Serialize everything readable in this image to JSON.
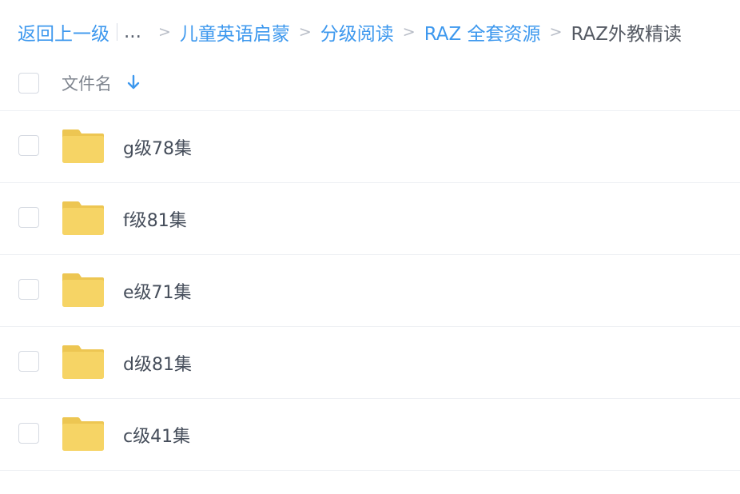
{
  "breadcrumb": {
    "back": "返回上一级",
    "ellipsis": "...",
    "separator": ">",
    "items": [
      "儿童英语启蒙",
      "分级阅读",
      "RAZ 全套资源"
    ],
    "current": "RAZ外教精读"
  },
  "header": {
    "label": "文件名",
    "sort_icon": "arrow-down-icon",
    "sort_direction": "descending"
  },
  "files": [
    {
      "name": "g级78集",
      "icon": "folder-icon"
    },
    {
      "name": "f级81集",
      "icon": "folder-icon"
    },
    {
      "name": "e级71集",
      "icon": "folder-icon"
    },
    {
      "name": "d级81集",
      "icon": "folder-icon"
    },
    {
      "name": "c级41集",
      "icon": "folder-icon"
    }
  ],
  "colors": {
    "link": "#3d98ee",
    "folder": "#f6d465",
    "folder_tab": "#edc652"
  }
}
